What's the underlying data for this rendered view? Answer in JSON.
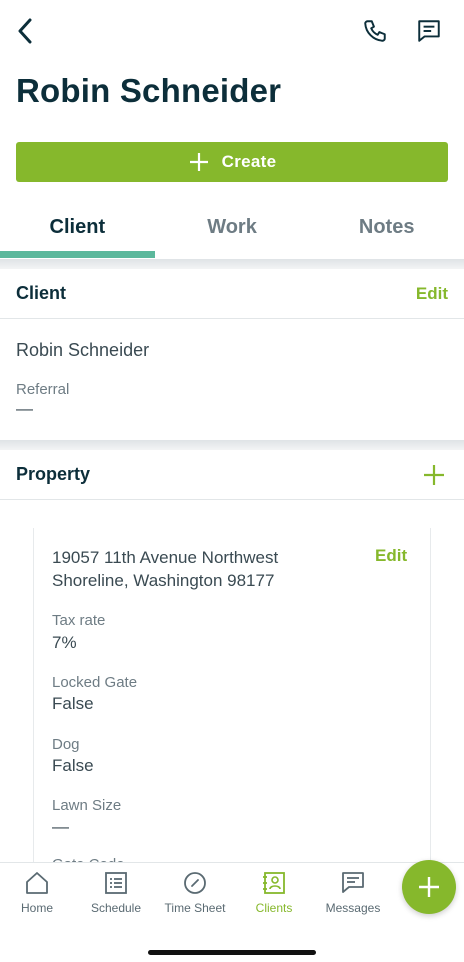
{
  "header": {
    "title": "Robin Schneider",
    "icons": [
      "chevron-left-icon",
      "phone-icon",
      "message-icon"
    ]
  },
  "create_button": {
    "label": "Create"
  },
  "tabs": [
    {
      "label": "Client",
      "active": true
    },
    {
      "label": "Work",
      "active": false
    },
    {
      "label": "Notes",
      "active": false
    }
  ],
  "client_section": {
    "title": "Client",
    "edit_label": "Edit",
    "name": "Robin Schneider",
    "referral_label": "Referral",
    "referral_value": "—"
  },
  "property_section": {
    "title": "Property",
    "address_line1": "19057 11th Avenue Northwest",
    "address_line2": "Shoreline, Washington 98177",
    "edit_label": "Edit",
    "fields": [
      {
        "label": "Tax rate",
        "value": "7%"
      },
      {
        "label": "Locked Gate",
        "value": "False"
      },
      {
        "label": "Dog",
        "value": "False"
      },
      {
        "label": "Lawn Size",
        "value": "—"
      }
    ],
    "partial_label": "Gate Code"
  },
  "bottom_nav": {
    "items": [
      {
        "label": "Home",
        "icon": "home-icon",
        "active": false
      },
      {
        "label": "Schedule",
        "icon": "schedule-icon",
        "active": false
      },
      {
        "label": "Time Sheet",
        "icon": "timesheet-icon",
        "active": false
      },
      {
        "label": "Clients",
        "icon": "clients-icon",
        "active": true
      },
      {
        "label": "Messages",
        "icon": "messages-icon",
        "active": false
      }
    ]
  },
  "colors": {
    "brand_green": "#86b82c",
    "dark_text": "#0c2e3a",
    "tab_indicator": "#5bb89c"
  }
}
